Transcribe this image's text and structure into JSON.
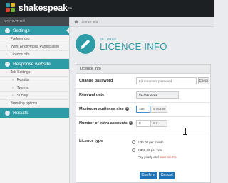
{
  "app": {
    "brand": "shakespeak",
    "trademark": "TM",
    "colors": {
      "accent": "#2e9ca6",
      "topbar": "#1d2023",
      "primary_button": "#1f74b8",
      "discount": "#d9432f"
    }
  },
  "sidebar": {
    "header": "NAVIGATION",
    "sections": [
      {
        "label": "Settings",
        "icon": "gear-icon"
      },
      {
        "label": "Response website",
        "icon": "globe-icon"
      },
      {
        "label": "Results",
        "icon": "chart-icon"
      }
    ],
    "settings_items": [
      {
        "label": "Preferences"
      },
      {
        "label": "[Non] Anonymous Participation"
      },
      {
        "label": "Licence info"
      }
    ],
    "response_items": [
      {
        "label": "Tab Settings"
      },
      {
        "label": "Results"
      },
      {
        "label": "Tweets"
      },
      {
        "label": "Survey"
      },
      {
        "label": "Branding options"
      }
    ],
    "chevron": "›"
  },
  "breadcrumb": {
    "current": "Licence info"
  },
  "header": {
    "small": "SETTINGS",
    "title": "LICENCE INFO",
    "icon": "pencil-icon"
  },
  "panel": {
    "title": "Licence Info",
    "change_password": {
      "label": "Change password",
      "placeholder": "Fill in current password",
      "button": "Check"
    },
    "renewal_date": {
      "label": "Renewal date",
      "value": "01 Sep 2014"
    },
    "audience": {
      "label": "Maximum audience size",
      "help": "?",
      "value": "100",
      "price": "€ 350.00"
    },
    "extra_accounts": {
      "label": "Number of extra accounts",
      "help": "?",
      "value": "0",
      "price": "€ 0"
    },
    "licence_type": {
      "label": "Licence type",
      "options": [
        {
          "label": "€ 35.00 per month",
          "selected": false
        },
        {
          "label": "€ 350.00 per year",
          "selected": true
        }
      ],
      "note_prefix": "Pay yearly and ",
      "note_highlight": "save 16.6%"
    },
    "confirm": "Confirm",
    "cancel": "Cancel"
  }
}
